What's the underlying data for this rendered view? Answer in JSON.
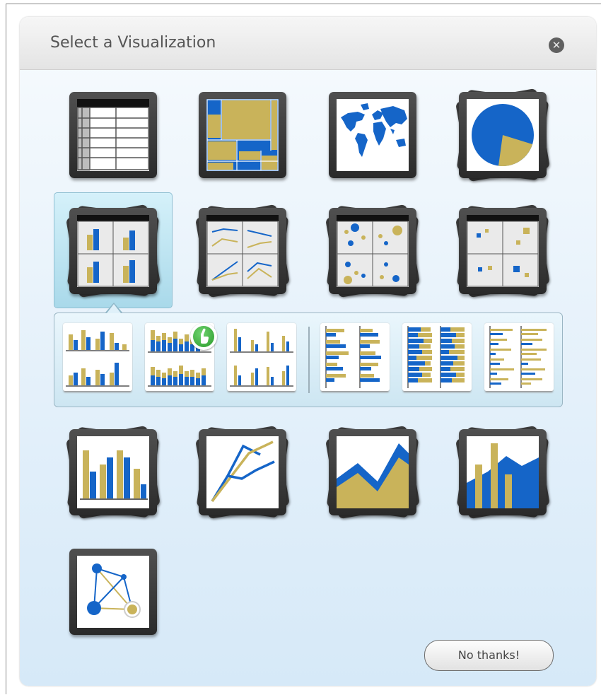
{
  "dialog": {
    "title": "Select a Visualization",
    "close_icon": "close-circle-icon",
    "no_thanks_label": "No thanks!"
  },
  "colors": {
    "blue": "#1565c8",
    "gold": "#c9b35a",
    "tile_frame": "#3a3a3a",
    "selection_highlight": "#b8e2f0",
    "badge_green": "#3aaa3a"
  },
  "visualizations": [
    {
      "name": "grid",
      "icon": "table-grid-icon"
    },
    {
      "name": "treemap",
      "icon": "treemap-icon"
    },
    {
      "name": "map",
      "icon": "world-map-icon"
    },
    {
      "name": "pie",
      "icon": "pie-chart-icon"
    },
    {
      "name": "small-multiples-bar",
      "icon": "small-multiples-bar-icon",
      "selected": true
    },
    {
      "name": "small-multiples-line",
      "icon": "small-multiples-line-icon"
    },
    {
      "name": "small-multiples-bubble",
      "icon": "small-multiples-bubble-icon"
    },
    {
      "name": "small-multiples-scatter",
      "icon": "small-multiples-scatter-icon"
    },
    {
      "name": "bar",
      "icon": "bar-chart-icon"
    },
    {
      "name": "line",
      "icon": "line-chart-icon"
    },
    {
      "name": "area",
      "icon": "area-chart-icon"
    },
    {
      "name": "combo",
      "icon": "combo-chart-icon"
    },
    {
      "name": "network",
      "icon": "network-graph-icon"
    }
  ],
  "subtypes": [
    {
      "name": "column-clustered",
      "icon": "column-clustered-icon"
    },
    {
      "name": "column-stacked",
      "icon": "column-stacked-icon",
      "hovered": true
    },
    {
      "name": "column-separate",
      "icon": "column-separate-icon"
    },
    {
      "name": "bar-clustered",
      "icon": "bar-clustered-icon"
    },
    {
      "name": "bar-stacked",
      "icon": "bar-stacked-icon"
    },
    {
      "name": "bar-separate",
      "icon": "bar-separate-icon"
    }
  ],
  "hover_badge": {
    "icon": "hand-pointer-icon"
  }
}
